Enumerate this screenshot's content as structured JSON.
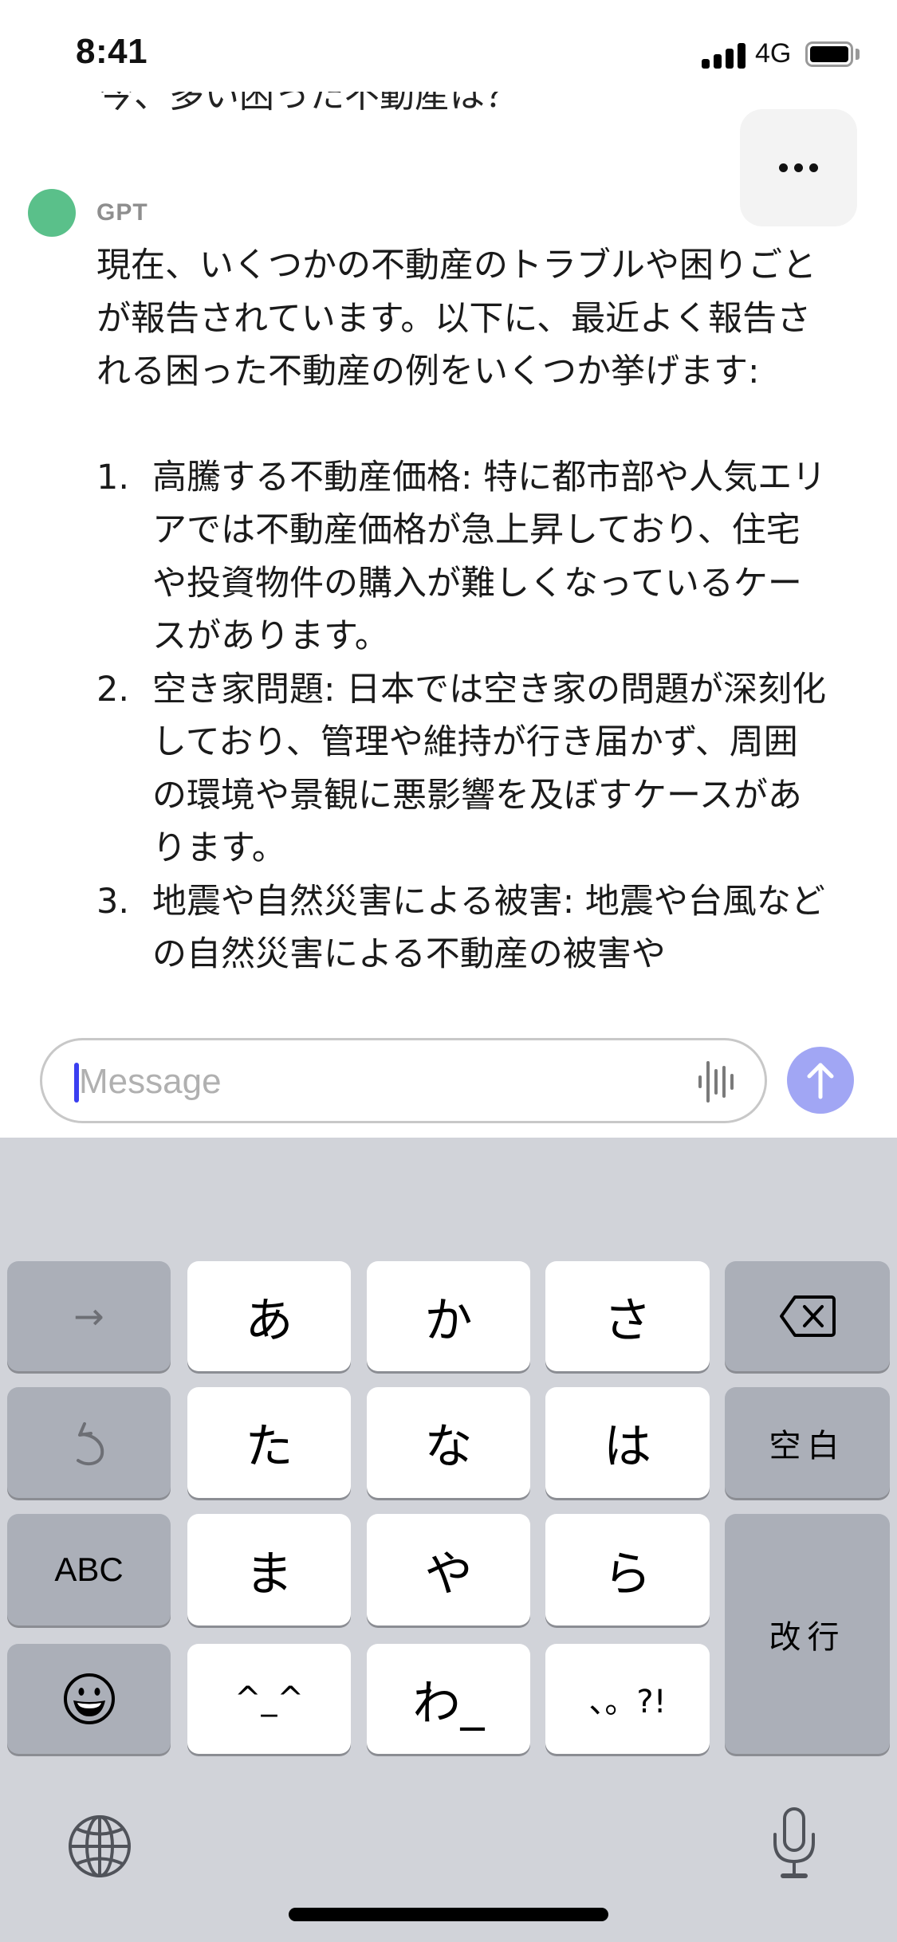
{
  "status_bar": {
    "time": "8:41",
    "network": "4G",
    "icons": [
      "signal-icon",
      "battery-icon"
    ]
  },
  "chat": {
    "previous_user_message_clipped": "今、多い困った不動産は？",
    "more_button_icon": "ellipsis-icon",
    "assistant": {
      "sender": "GPT",
      "avatar_color": "#5ac08a",
      "intro": "現在、いくつかの不動産のトラブルや困りごとが報告されています。以下に、最近よく報告される困った不動産の例をいくつか挙げます:",
      "items": [
        {
          "num": "1.",
          "text": "高騰する不動産価格: 特に都市部や人気エリアでは不動産価格が急上昇しており、住宅や投資物件の購入が難しくなっているケースがあります。"
        },
        {
          "num": "2.",
          "text": "空き家問題: 日本では空き家の問題が深刻化しており、管理や維持が行き届かず、周囲の環境や景観に悪影響を及ぼすケースがあります。"
        },
        {
          "num": "3.",
          "text": "地震や自然災害による被害: 地震や台風などの自然災害による不動産の被害や"
        }
      ]
    }
  },
  "composer": {
    "placeholder": "Message",
    "value": "",
    "voice_icon": "voice-waveform-icon",
    "send_icon": "arrow-up-icon",
    "send_color": "#a1a6f4"
  },
  "keyboard": {
    "rows": [
      [
        {
          "label": "→",
          "kind": "dark",
          "name": "next-candidate-key"
        },
        {
          "label": "あ",
          "kind": "light",
          "name": "key-a"
        },
        {
          "label": "か",
          "kind": "light",
          "name": "key-ka"
        },
        {
          "label": "さ",
          "kind": "light",
          "name": "key-sa"
        },
        {
          "label": "",
          "kind": "dark",
          "name": "delete-key",
          "icon": "backspace-icon"
        }
      ],
      [
        {
          "label": "",
          "kind": "dark",
          "name": "undo-key",
          "icon": "undo-icon"
        },
        {
          "label": "た",
          "kind": "light",
          "name": "key-ta"
        },
        {
          "label": "な",
          "kind": "light",
          "name": "key-na"
        },
        {
          "label": "は",
          "kind": "light",
          "name": "key-ha"
        },
        {
          "label": "空白",
          "kind": "dark",
          "name": "space-key"
        }
      ],
      [
        {
          "label": "ABC",
          "kind": "dark",
          "name": "abc-key"
        },
        {
          "label": "ま",
          "kind": "light",
          "name": "key-ma"
        },
        {
          "label": "や",
          "kind": "light",
          "name": "key-ya"
        },
        {
          "label": "ら",
          "kind": "light",
          "name": "key-ra"
        }
      ],
      [
        {
          "label": "",
          "kind": "dark",
          "name": "emoji-key",
          "icon": "emoji-icon"
        },
        {
          "label": "^_^",
          "kind": "light",
          "name": "key-kaomoji"
        },
        {
          "label": "わ_",
          "kind": "light",
          "name": "key-wa"
        },
        {
          "label": "、。?!",
          "kind": "light",
          "name": "key-punctuation"
        }
      ]
    ],
    "return_label": "改行",
    "globe_icon": "globe-icon",
    "mic_icon": "microphone-icon"
  }
}
